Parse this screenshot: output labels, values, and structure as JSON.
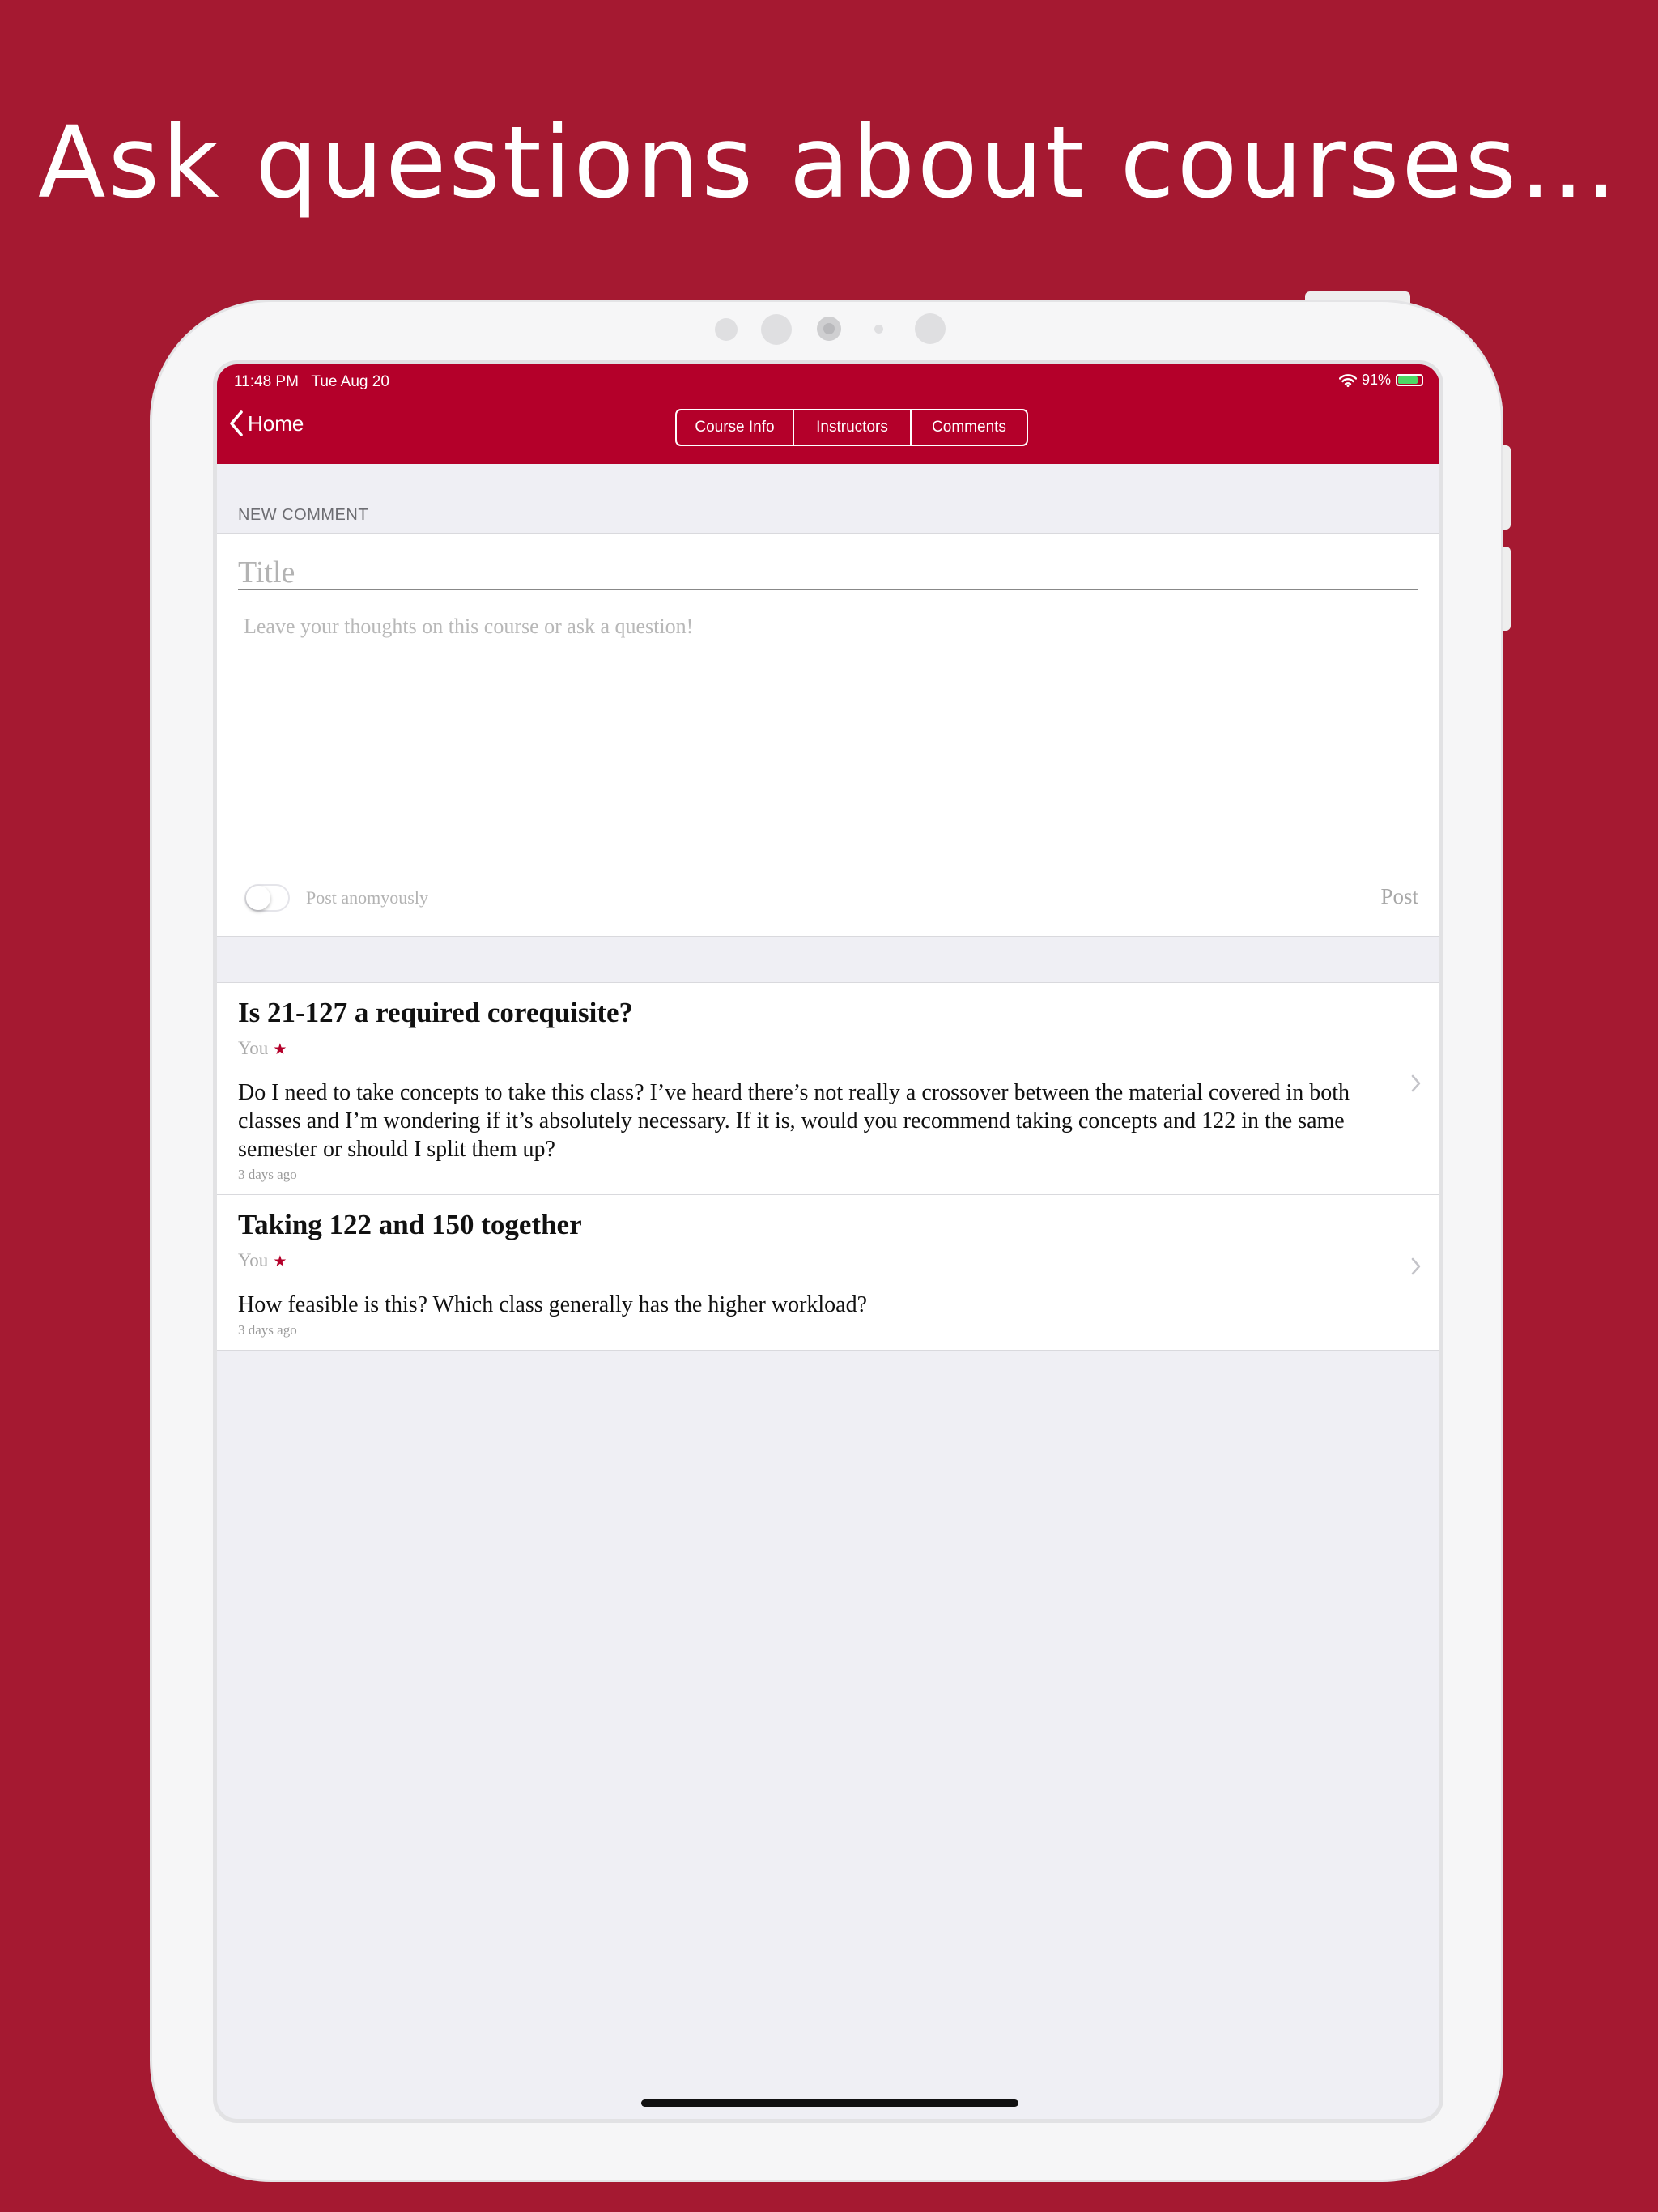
{
  "headline": "Ask questions about courses…",
  "status_bar": {
    "time": "11:48 PM",
    "date": "Tue Aug 20",
    "battery": "91%",
    "battery_level": 0.91
  },
  "nav": {
    "back_label": "Home",
    "segments": [
      "Course Info",
      "Instructors",
      "Comments"
    ],
    "active_segment": "Comments"
  },
  "new_comment": {
    "section_label": "NEW COMMENT",
    "title_placeholder": "Title",
    "body_placeholder": "Leave your thoughts on this course or ask a question!",
    "anonymous_label": "Post anomyously",
    "anonymous_on": false,
    "post_label": "Post"
  },
  "comments": [
    {
      "title": "Is 21-127 a required corequisite?",
      "author": "You",
      "star": "★",
      "body": "Do I need to take concepts to take this class?  I’ve heard there’s not really a crossover between the material covered in both classes and I’m wondering if it’s absolutely necessary.  If it is, would you recommend taking concepts and 122 in the same semester or should I split them up?",
      "time": "3 days ago"
    },
    {
      "title": "Taking 122 and 150 together",
      "author": "You",
      "star": "★",
      "body": "How feasible is this?  Which class generally has the higher workload?",
      "time": "3 days ago"
    }
  ],
  "colors": {
    "background": "#a51931",
    "accent": "#b4002a",
    "battery_green": "#4cd964"
  },
  "icons": [
    "back-chevron-icon",
    "wifi-icon",
    "battery-icon",
    "star-icon",
    "chevron-right-icon"
  ]
}
